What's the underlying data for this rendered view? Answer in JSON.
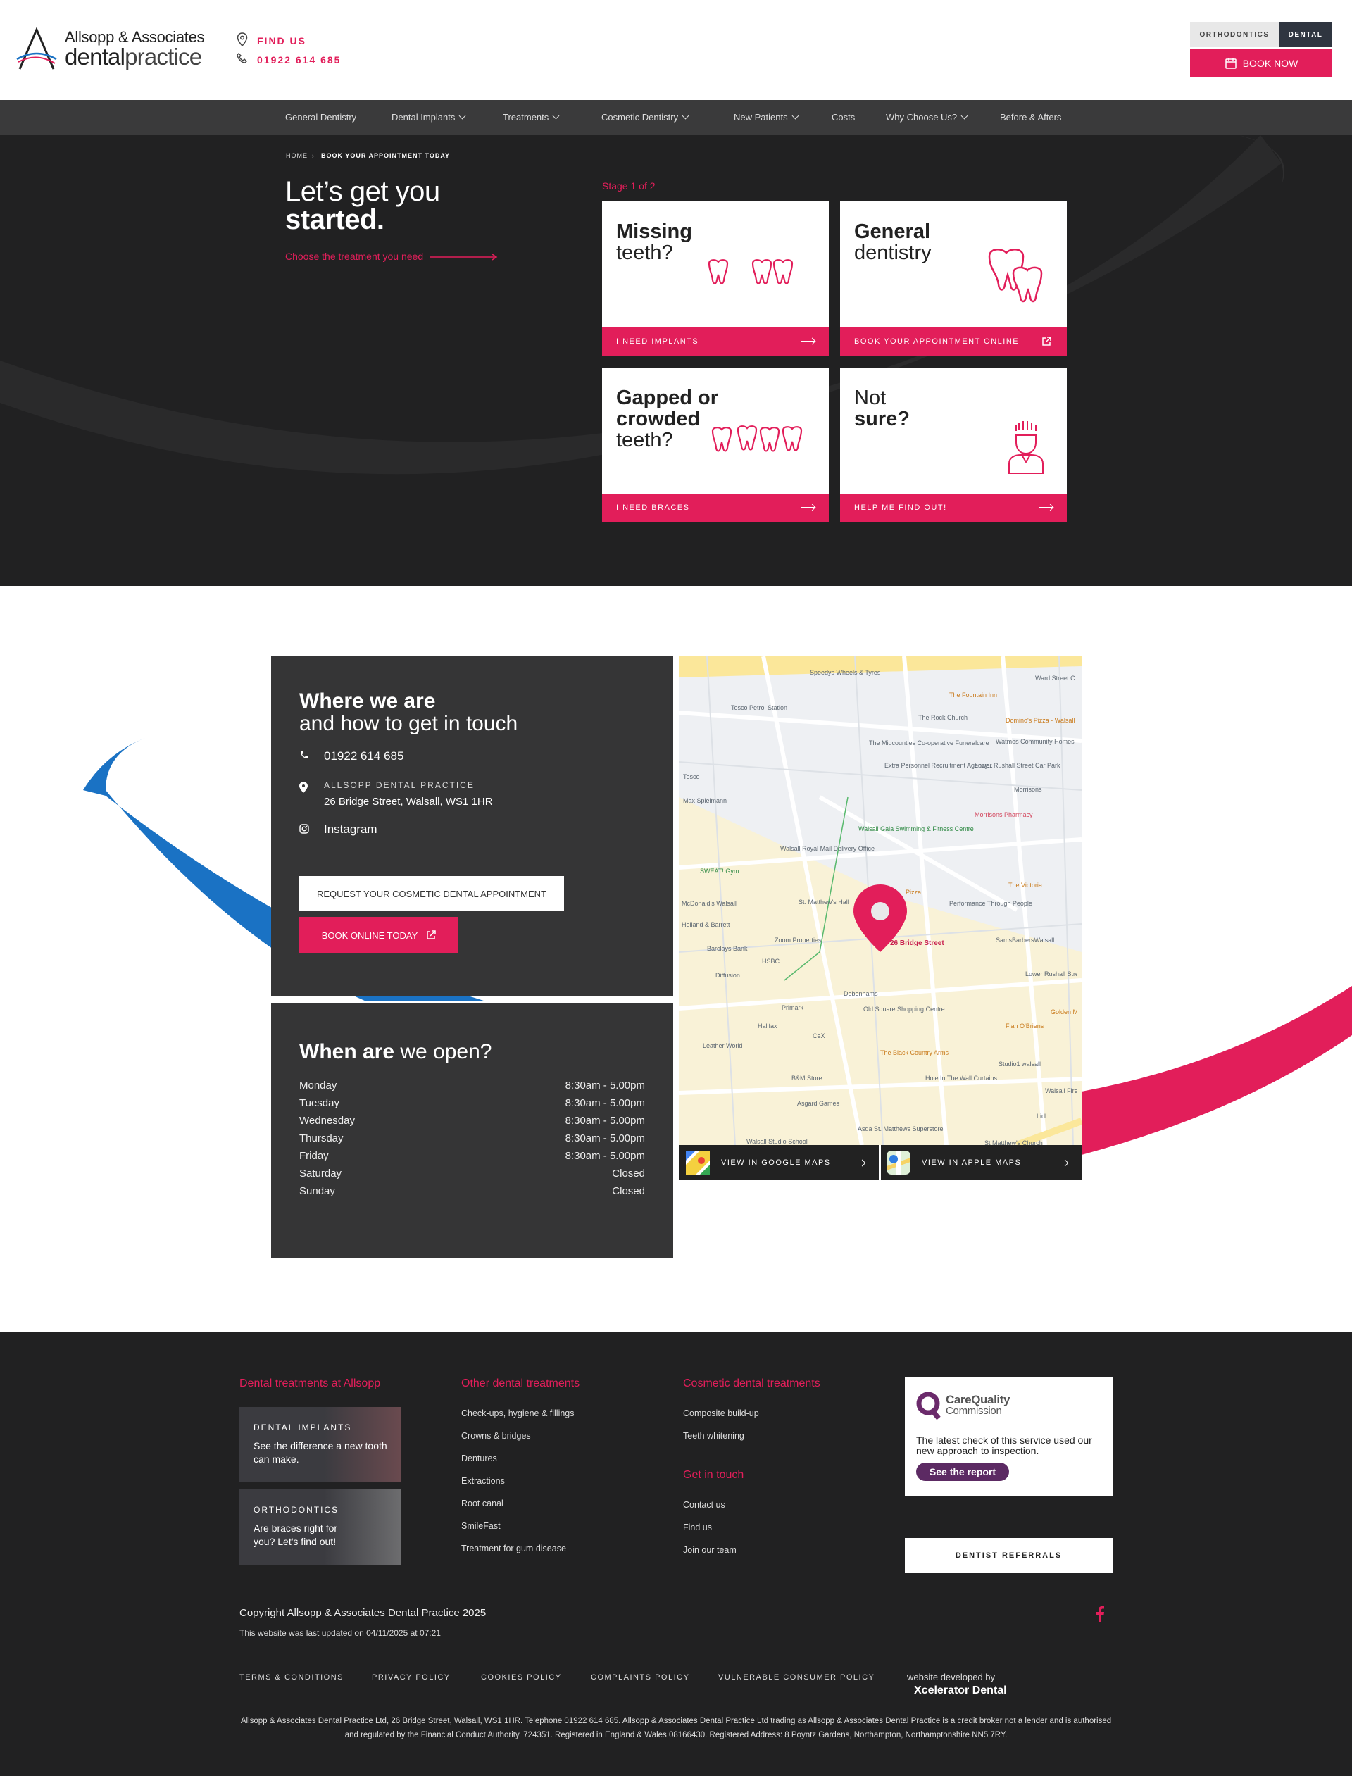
{
  "header": {
    "logo_line1": "Allsopp & Associates",
    "logo_line2_a": "dental",
    "logo_line2_b": "practice",
    "find_us": "FIND US",
    "phone": "01922 614 685",
    "switch_orthodontics": "ORTHODONTICS",
    "switch_dental": "DENTAL",
    "book_now": "BOOK NOW"
  },
  "nav": {
    "items": [
      {
        "label": "General Dentistry"
      },
      {
        "label": "Dental Implants"
      },
      {
        "label": "Treatments"
      },
      {
        "label": "Cosmetic Dentistry"
      },
      {
        "label": "New Patients"
      },
      {
        "label": "Costs"
      },
      {
        "label": "Why Choose Us?"
      },
      {
        "label": "Before & Afters"
      }
    ]
  },
  "hero": {
    "breadcrumb_home": "HOME",
    "breadcrumb_sep": "›",
    "breadcrumb_current": "BOOK YOUR APPOINTMENT TODAY",
    "title_line1": "Let’s get you",
    "title_line2": "started.",
    "choose": "Choose the treatment you need",
    "stage": "Stage 1 of 2",
    "cards": [
      {
        "title_bold": "Missing",
        "title_rest": "teeth?",
        "cta": "I NEED IMPLANTS"
      },
      {
        "title_bold": "General",
        "title_rest": "dentistry",
        "cta": "BOOK YOUR APPOINTMENT ONLINE"
      },
      {
        "title_bold": "Gapped or crowded",
        "title_rest": "teeth?",
        "cta": "I NEED BRACES"
      },
      {
        "title_bold": "sure?",
        "title_rest": "Not",
        "cta": "HELP ME FIND OUT!"
      }
    ]
  },
  "location": {
    "heading_bold": "Where we are",
    "heading_rest": "and how to get in touch",
    "phone": "01922 614 685",
    "practice_name": "ALLSOPP DENTAL PRACTICE",
    "address": "26 Bridge Street, Walsall, WS1 1HR",
    "instagram": "Instagram",
    "request_btn": "REQUEST YOUR COSMETIC DENTAL APPOINTMENT",
    "book_btn": "BOOK ONLINE TODAY",
    "map_pin_label": "26 Bridge Street",
    "google_maps": "VIEW IN GOOGLE MAPS",
    "apple_maps": "VIEW IN APPLE MAPS"
  },
  "hours": {
    "heading_bold": "When are",
    "heading_rest": "we open?",
    "rows": [
      {
        "day": "Monday",
        "time": "8:30am - 5.00pm"
      },
      {
        "day": "Tuesday",
        "time": "8:30am - 5.00pm"
      },
      {
        "day": "Wednesday",
        "time": "8:30am - 5.00pm"
      },
      {
        "day": "Thursday",
        "time": "8:30am - 5.00pm"
      },
      {
        "day": "Friday",
        "time": "8:30am - 5.00pm"
      },
      {
        "day": "Saturday",
        "time": "Closed"
      },
      {
        "day": "Sunday",
        "time": "Closed"
      }
    ]
  },
  "map_labels": [
    "Speedys Wheels & Tyres",
    "Tesco Petrol Station",
    "The Fountain Inn",
    "The Rock Church",
    "Domino's Pizza - Walsall",
    "The Midcounties Co-operative Funeralcare",
    "Watmos Community Homes",
    "Extra Personnel Recruitment Agency...",
    "Lower Rushall Street Car Park",
    "Tesco",
    "Max Spielmann",
    "Morrisons",
    "Morrisons Pharmacy",
    "Walsall Gala Swimming & Fitness Centre",
    "Walsall Royal Mail Delivery Office",
    "SWEAT! Gym",
    "McDonald's Walsall",
    "St. Matthew's Hall",
    "Pizza",
    "The Victoria",
    "Performance Through People",
    "Holland & Barrett",
    "Barclays Bank",
    "Zoom Properties",
    "SamsBarbersWalsall",
    "HSBC",
    "Diffusion",
    "Lower Rushall Street Long Stay",
    "Debenhams",
    "Primark",
    "Old Square Shopping Centre",
    "Golden M",
    "Flan O'Briens",
    "Halifax",
    "CeX",
    "Leather World",
    "The Black Country Arms",
    "Studio1 walsall",
    "B&M Store",
    "Hole In The Wall Curtains",
    "Walsall Fire",
    "Asgard Games",
    "Lidl",
    "Asda St. Matthews Superstore",
    "Walsall Studio School",
    "St Matthew's Church",
    "Ward Street C"
  ],
  "footer": {
    "col1_heading": "Dental treatments at Allsopp",
    "promo1_label": "DENTAL IMPLANTS",
    "promo1_text": "See the difference a new tooth can make.",
    "promo2_label": "ORTHODONTICS",
    "promo2_text": "Are braces right for you? Let's find out!",
    "col2_heading": "Other dental treatments",
    "col2_links": [
      "Check-ups, hygiene & fillings",
      "Crowns & bridges",
      "Dentures",
      "Extractions",
      "Root canal",
      "SmileFast",
      "Treatment for gum disease"
    ],
    "col3_heading": "Cosmetic dental treatments",
    "col3_links": [
      "Composite build-up",
      "Teeth whitening"
    ],
    "col3b_heading": "Get in touch",
    "col3b_links": [
      "Contact us",
      "Find us",
      "Join our team"
    ],
    "cqc_name1": "CareQuality",
    "cqc_name2": "Commission",
    "cqc_text": "The latest check of this service used our new approach to inspection.",
    "cqc_button": "See the report",
    "referrals": "DENTIST REFERRALS",
    "copyright": "Copyright Allsopp & Associates Dental Practice 2025",
    "updated": "This website was last updated on 04/11/2025 at 07:21",
    "legal_links": [
      "TERMS & CONDITIONS",
      "PRIVACY POLICY",
      "COOKIES POLICY",
      "COMPLAINTS POLICY",
      "VULNERABLE CONSUMER POLICY"
    ],
    "developed_by": "website developed by",
    "developer": "Xcelerator Dental",
    "disclaimer": "Allsopp & Associates Dental Practice Ltd, 26 Bridge Street, Walsall, WS1 1HR. Telephone 01922 614 685. Allsopp & Associates Dental Practice Ltd trading as Allsopp & Associates Dental Practice is a credit broker not a lender and is authorised and regulated by the Financial Conduct Authority, 724351. Registered in England & Wales 08166430. Registered Address: 8 Poyntz Gardens, Northampton, Northamptonshire NN5 7RY."
  },
  "colors": {
    "accent": "#e21e5a",
    "dark": "#212122",
    "panel": "#353536",
    "nav": "#3a3a3b",
    "blue_swoosh": "#1a72c4"
  }
}
